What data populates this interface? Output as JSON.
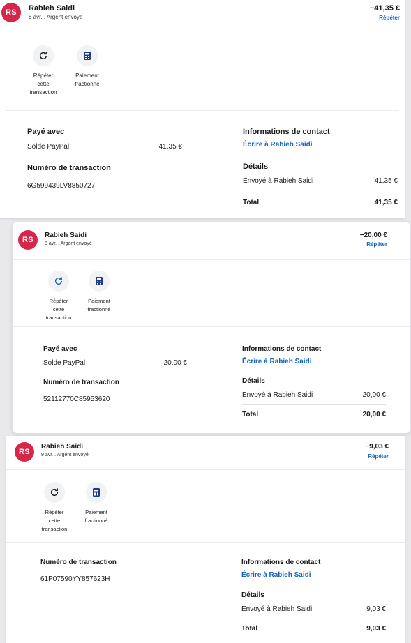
{
  "colors": {
    "accent": "#1565c0",
    "avatar": "#d6264a"
  },
  "transactions": [
    {
      "initials": "RS",
      "name": "Rabieh Saidi",
      "subtitle": "8 avr. . Argent envoyé",
      "amount": "−41,35 €",
      "repeat_link": "Répéter",
      "actions": [
        {
          "label": "Répéter cette transaction",
          "icon": "refresh-icon"
        },
        {
          "label": "Paiement fractionné",
          "icon": "calculator-icon"
        }
      ],
      "paid_with_label": "Payé avec",
      "paid_with_source": "Solde PayPal",
      "paid_with_amount": "41,35 €",
      "transaction_number_label": "Numéro de transaction",
      "transaction_number": "6G599439LV8850727",
      "contact_label": "Informations de contact",
      "contact_link": "Écrire à Rabieh Saidi",
      "details_label": "Détails",
      "details_row": "Envoyé à Rabieh Saidi",
      "details_amount": "41,35 €",
      "total_label": "Total",
      "total_amount": "41,35 €"
    },
    {
      "initials": "RS",
      "name": "Rabieh Saidi",
      "subtitle": "8 avr. . Argent envoyé",
      "amount": "−20,00 €",
      "repeat_link": "Répéter",
      "actions": [
        {
          "label": "Répéter cette transaction",
          "icon": "refresh-icon"
        },
        {
          "label": "Paiement fractionné",
          "icon": "calculator-icon"
        }
      ],
      "paid_with_label": "Payé avec",
      "paid_with_source": "Solde PayPal",
      "paid_with_amount": "20,00 €",
      "transaction_number_label": "Numéro de transaction",
      "transaction_number": "52112770C85953620",
      "contact_label": "Informations de contact",
      "contact_link": "Écrire à Rabieh Saidi",
      "details_label": "Détails",
      "details_row": "Envoyé à Rabieh Saidi",
      "details_amount": "20,00 €",
      "total_label": "Total",
      "total_amount": "20,00 €"
    },
    {
      "initials": "RS",
      "name": "Rabieh Saidi",
      "subtitle": "9 avr. . Argent envoyé",
      "amount": "−9,03 €",
      "repeat_link": "Répéter",
      "actions": [
        {
          "label": "Répéter cette transaction",
          "icon": "refresh-icon"
        },
        {
          "label": "Paiement fractionné",
          "icon": "calculator-icon"
        }
      ],
      "transaction_number_label": "Numéro de transaction",
      "transaction_number": "61P07590YY857623H",
      "contact_label": "Informations de contact",
      "contact_link": "Écrire à Rabieh Saidi",
      "details_label": "Détails",
      "details_row": "Envoyé à Rabieh Saidi",
      "details_amount": "9,03 €",
      "total_label": "Total",
      "total_amount": "9,03 €"
    }
  ]
}
